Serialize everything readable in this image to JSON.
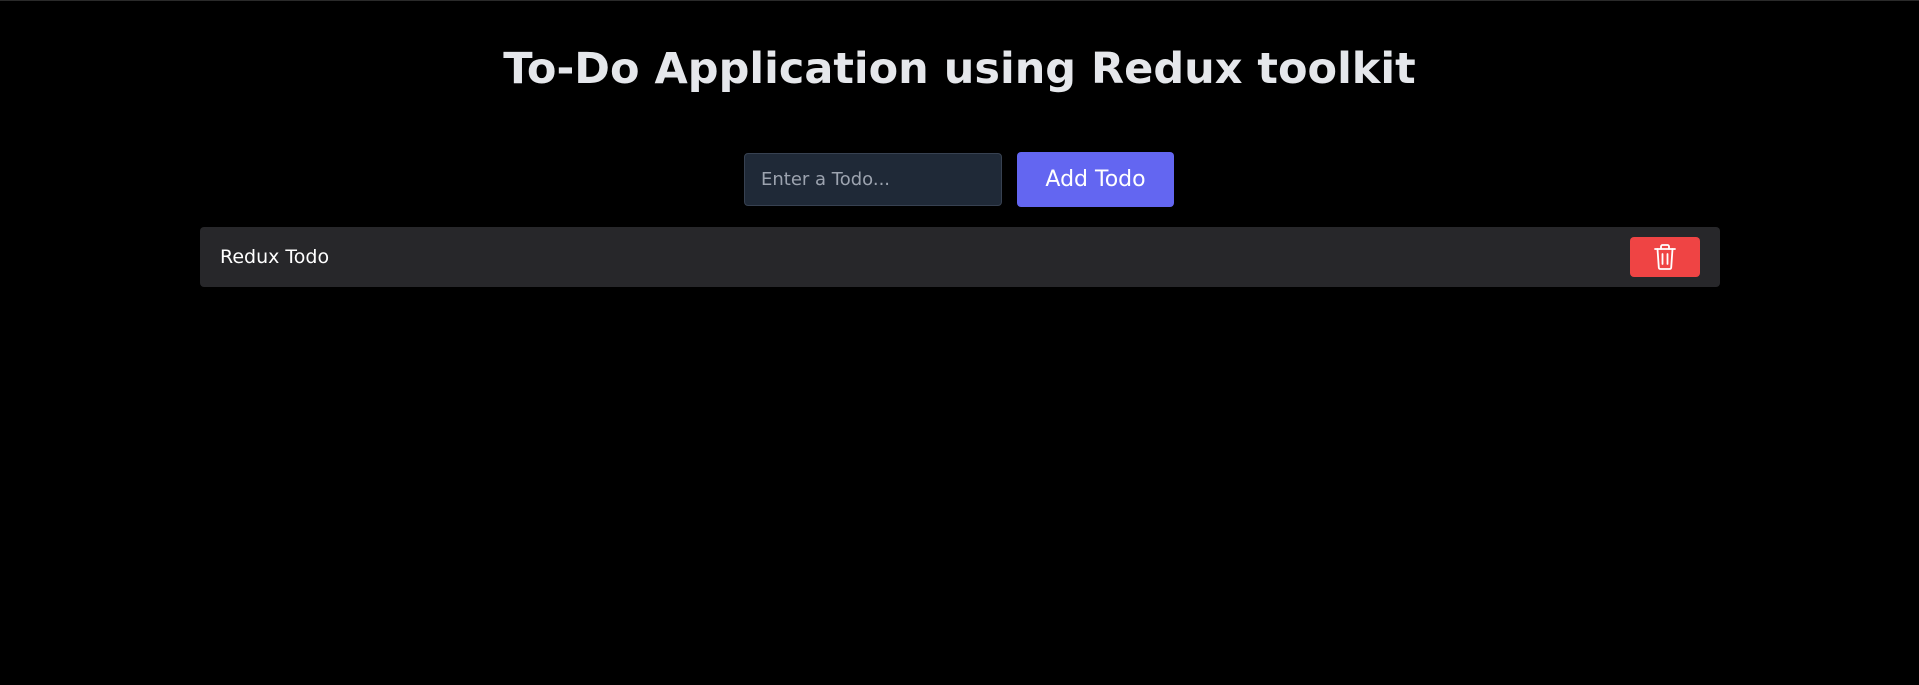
{
  "header": {
    "title": "To-Do Application using Redux toolkit"
  },
  "form": {
    "input_value": "",
    "input_placeholder": "Enter a Todo...",
    "add_label": "Add Todo"
  },
  "todos": [
    {
      "text": "Redux Todo",
      "delete_icon": "trash-icon"
    }
  ],
  "colors": {
    "background": "#000000",
    "title": "#e5e7eb",
    "input_bg": "#1f2937",
    "input_border": "#374151",
    "accent": "#6366f1",
    "todo_bg": "#27272a",
    "delete": "#ef4444"
  }
}
